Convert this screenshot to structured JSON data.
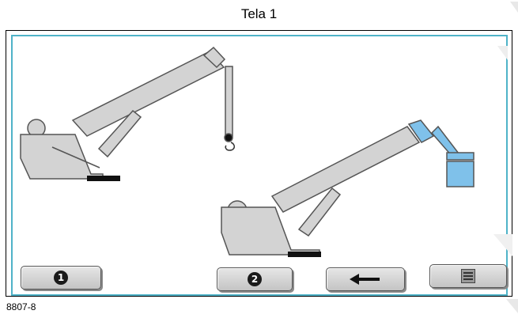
{
  "title": "Tela 1",
  "figure_id": "8807-8",
  "buttons": [
    {
      "name": "option-1-button",
      "icon": "number-1-icon",
      "label": "1"
    },
    {
      "name": "option-2-button",
      "icon": "number-2-icon",
      "label": "2"
    },
    {
      "name": "back-button",
      "icon": "arrow-left-icon"
    },
    {
      "name": "menu-button",
      "icon": "menu-icon"
    }
  ],
  "colors": {
    "screen_border": "#4fb3c8",
    "crane_body": "#d3d3d3",
    "crane_outline": "#555555",
    "highlight_blue": "#7fc1ea"
  }
}
